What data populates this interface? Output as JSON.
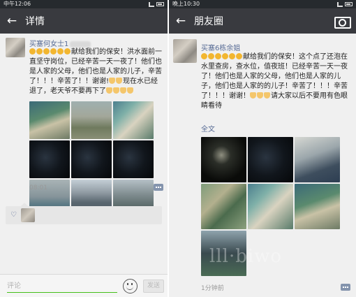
{
  "left": {
    "status": {
      "time": "中午12:06"
    },
    "header": {
      "back_icon": "arrow-left-icon",
      "title": "详情"
    },
    "post": {
      "author": "买塞何女士1",
      "text_line1": "献给我们的保安！洪水面前一直坚守岗位，已经辛苦一天一夜了！他们也是人家的父母，他们也是人家的儿子，辛苦了！！！辛苦了！！谢谢!",
      "text_line2": "现在水已经退了，老天爷不要再下了",
      "time": "08:01"
    },
    "likes": {
      "heart_icon": "heart-icon"
    },
    "comment_bar": {
      "placeholder": "评论",
      "emoji_icon": "smiley-icon",
      "send_label": "发送"
    }
  },
  "right": {
    "status": {
      "time": "晚上10:30"
    },
    "header": {
      "back_icon": "arrow-left-icon",
      "title": "朋友圈",
      "camera_icon": "camera-icon"
    },
    "post": {
      "author": "买塞6栋余姐",
      "text_part1": "献给我们的保安！这个点了还泡在水里查房，查水位，值夜班！已经辛苦一天一夜了！他们也是人家的父母，他们也是人家的儿子，他们也是人家的的儿子！辛苦了！！！辛苦了！！！谢",
      "text_part2": "谢！",
      "text_part3": "请大家以后不要用有色眼睛看待",
      "expand_label": "全文",
      "time": "1分钟前"
    },
    "watermark": "lll·biwo"
  },
  "colors": {
    "titlebar": "#393a3f",
    "name_link": "#576b95",
    "accent_green": "#45c01a",
    "page_bg": "#f0f0f0"
  }
}
